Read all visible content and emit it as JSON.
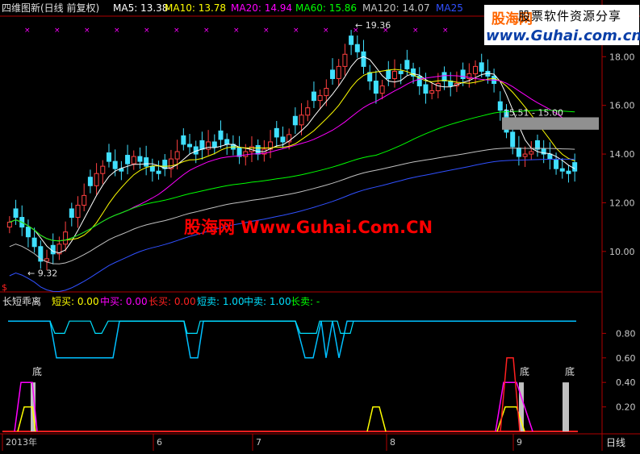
{
  "header": {
    "title": "四维图新(日线 前复权)",
    "ma": [
      {
        "label": "MA5: 13.38",
        "color": "#ffffff"
      },
      {
        "label": "MA10: 13.78",
        "color": "#ffff00"
      },
      {
        "label": "MA20: 14.94",
        "color": "#ff00ff"
      },
      {
        "label": "MA60: 15.86",
        "color": "#00ff00"
      },
      {
        "label": "MA120: 14.07",
        "color": "#c0c0c0"
      },
      {
        "label": "MA25",
        "color": "#3050ff"
      }
    ]
  },
  "watermark": {
    "center": "股海网 Www.Guhai.Com.CN",
    "logo": "股海网",
    "subtitle": "股票软件资源分享",
    "url": "www.Guhai.com.cn"
  },
  "chart_data": [
    {
      "type": "candlestick",
      "title": "四维图新(日线 前复权)",
      "ylim": [
        9.0,
        19.6
      ],
      "y_ticks": [
        "18.00",
        "16.00",
        "14.00",
        "12.00",
        "10.00"
      ],
      "annotations": {
        "high": "19.36",
        "low": "9.32",
        "zone": "15.51 - 15.00"
      },
      "closes": [
        11.2,
        11.4,
        11.0,
        10.6,
        10.2,
        9.6,
        9.7,
        9.9,
        10.3,
        10.8,
        11.4,
        11.9,
        12.3,
        12.7,
        13.2,
        13.5,
        13.7,
        13.4,
        13.3,
        13.6,
        13.9,
        13.7,
        13.5,
        13.3,
        13.2,
        13.4,
        13.8,
        14.1,
        14.4,
        14.3,
        14.0,
        14.2,
        14.5,
        14.3,
        14.6,
        14.4,
        14.2,
        13.9,
        14.1,
        14.3,
        14.0,
        14.2,
        14.5,
        14.7,
        14.5,
        14.8,
        15.2,
        15.6,
        15.9,
        16.2,
        16.4,
        16.7,
        17.1,
        17.6,
        18.1,
        18.5,
        18.2,
        17.6,
        17.0,
        16.5,
        16.8,
        17.1,
        17.4,
        17.3,
        17.5,
        17.2,
        16.8,
        16.5,
        16.6,
        16.9,
        17.0,
        16.8,
        16.9,
        17.1,
        17.3,
        17.6,
        17.4,
        17.2,
        16.9,
        15.8,
        14.9,
        14.3,
        13.9,
        14.0,
        14.1,
        14.2,
        14.0,
        13.8,
        13.4,
        13.3,
        13.2,
        13.3
      ],
      "ma_series": [
        "MA5",
        "MA10",
        "MA20",
        "MA60",
        "MA120",
        "MA25"
      ],
      "x_labels": [
        "2013年",
        "6",
        "7",
        "8",
        "9"
      ]
    },
    {
      "type": "line",
      "title": "长短乖离",
      "ylim": [
        0,
        1.0
      ],
      "y_ticks": [
        "0.80",
        "0.60",
        "0.40",
        "0.20"
      ],
      "legend": [
        {
          "label": "短买: 0.00",
          "color": "#ffff00"
        },
        {
          "label": "中买: 0.00",
          "color": "#ff00ff"
        },
        {
          "label": "长买: 0.00",
          "color": "#ff2020"
        },
        {
          "label": "短卖: 1.00",
          "color": "#00e0ff"
        },
        {
          "label": "中卖: 1.00",
          "color": "#00e0ff"
        },
        {
          "label": "长卖: -",
          "color": "#00ff00"
        }
      ],
      "signal_labels": [
        "底",
        "底",
        "底"
      ]
    }
  ],
  "footer": {
    "period": "日线",
    "red_marker": "$"
  }
}
